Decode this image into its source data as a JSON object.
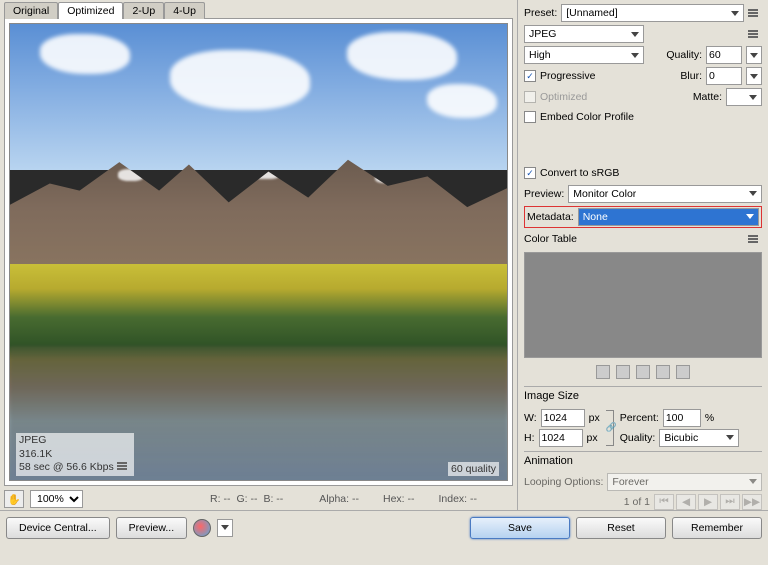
{
  "tabs": [
    "Original",
    "Optimized",
    "2-Up",
    "4-Up"
  ],
  "active_tab": "Optimized",
  "info": {
    "format": "JPEG",
    "filesize": "316.1K",
    "transfer": "58 sec @ 56.6 Kbps",
    "quality_tag": "60 quality"
  },
  "zoom": [
    "100%"
  ],
  "readouts": {
    "r": "R: --",
    "g": "G: --",
    "b": "B: --",
    "alpha": "Alpha: --",
    "hex": "Hex: --",
    "index": "Index: --"
  },
  "panel": {
    "preset_label": "Preset:",
    "preset_value": "[Unnamed]",
    "format_value": "JPEG",
    "quality_name": "High",
    "quality_label": "Quality:",
    "quality_value": "60",
    "progressive": "Progressive",
    "blur_label": "Blur:",
    "blur_value": "0",
    "optimized": "Optimized",
    "matte_label": "Matte:",
    "embed": "Embed Color Profile",
    "convert_srgb": "Convert to sRGB",
    "preview_label": "Preview:",
    "preview_value": "Monitor Color",
    "metadata_label": "Metadata:",
    "metadata_value": "None",
    "color_table_title": "Color Table",
    "image_size_title": "Image Size",
    "w_label": "W:",
    "w_val": "1024",
    "h_label": "H:",
    "h_val": "1024",
    "px": "px",
    "percent_label": "Percent:",
    "percent_val": "100",
    "percent_suffix": "%",
    "quality_resample_label": "Quality:",
    "resample_value": "Bicubic",
    "animation_title": "Animation",
    "looping_label": "Looping Options:",
    "looping_value": "Forever",
    "page_of": "1 of 1"
  },
  "buttons": {
    "device_central": "Device Central...",
    "preview": "Preview...",
    "save": "Save",
    "reset": "Reset",
    "remember": "Remember"
  }
}
